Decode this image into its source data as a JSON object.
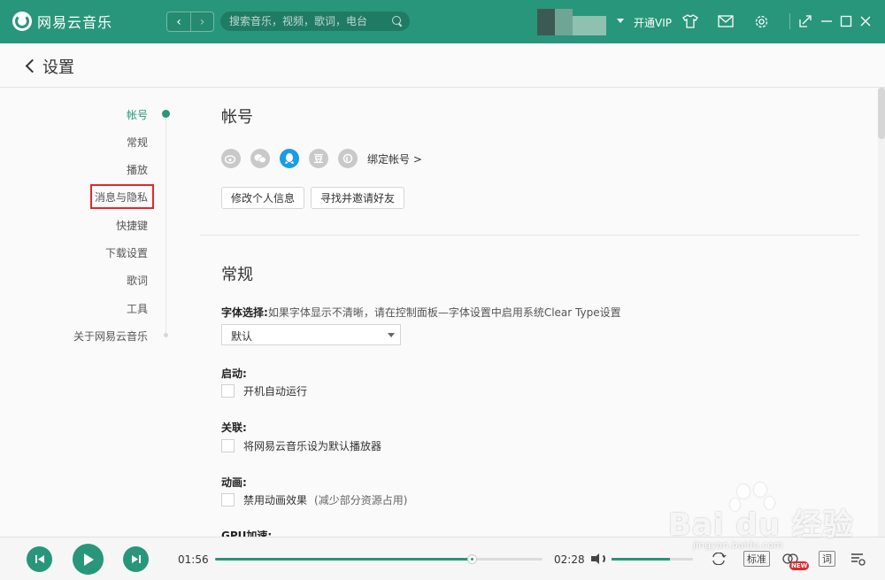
{
  "app": {
    "title": "网易云音乐",
    "accent_color": "#28967a"
  },
  "topbar": {
    "back_icon": "chevron-left-icon",
    "forward_icon": "chevron-right-icon",
    "search_placeholder": "搜索音乐，视频，歌词，电台",
    "vip_label": "开通VIP",
    "icons": [
      "tshirt-icon",
      "mail-icon",
      "gear-icon",
      "mini-mode-icon",
      "minimize-icon",
      "maximize-icon",
      "close-icon"
    ]
  },
  "header": {
    "title": "设置"
  },
  "sidebar": {
    "items": [
      {
        "label": "帐号",
        "active": true
      },
      {
        "label": "常规"
      },
      {
        "label": "播放"
      },
      {
        "label": "消息与隐私",
        "highlighted": true
      },
      {
        "label": "快捷键"
      },
      {
        "label": "下载设置"
      },
      {
        "label": "歌词"
      },
      {
        "label": "工具"
      },
      {
        "label": "关于网易云音乐"
      }
    ]
  },
  "account": {
    "title": "帐号",
    "social_icons": [
      "weibo-icon",
      "wechat-icon",
      "qq-icon",
      "douban-icon",
      "yixin-icon"
    ],
    "douban_glyph": "豆",
    "bind_link": "绑定帐号 >",
    "edit_profile_button": "修改个人信息",
    "find_friends_button": "寻找并邀请好友"
  },
  "general": {
    "title": "常规",
    "font_label": "字体选择:",
    "font_hint": "如果字体显示不清晰，请在控制面板—字体设置中启用系统Clear Type设置",
    "font_value": "默认",
    "startup_label": "启动:",
    "startup_option": "开机自动运行",
    "association_label": "关联:",
    "association_option": "将网易云音乐设为默认播放器",
    "animation_label": "动画:",
    "animation_option": "禁用动画效果",
    "animation_note": "(减少部分资源占用)",
    "gpu_label": "GPU加速:"
  },
  "player": {
    "current_time": "01:56",
    "total_time": "02:28",
    "progress": 0.787,
    "volume": 0.72,
    "quality_label": "标准",
    "new_badge": "NEW",
    "lyrics_label": "词"
  },
  "watermark": {
    "main": "Bai du 经验",
    "sub": "jingyan.baidu.com"
  }
}
